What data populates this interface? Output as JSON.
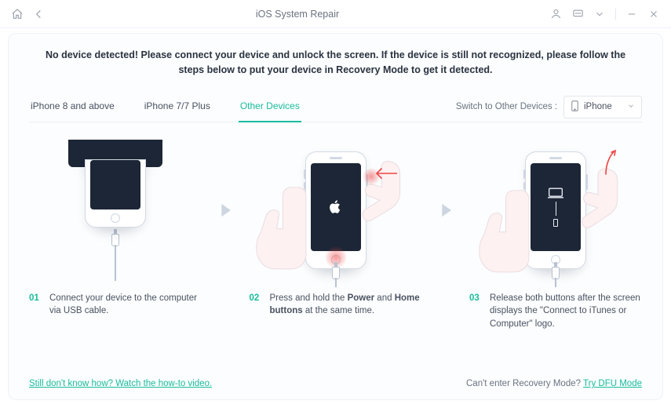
{
  "titlebar": {
    "title": "iOS System Repair"
  },
  "instructions": "No device detected! Please connect your device and unlock the screen. If the device is still not recognized, please follow the steps below to put your device in Recovery Mode to get it detected.",
  "tabs": {
    "items": [
      {
        "label": "iPhone 8 and above"
      },
      {
        "label": "iPhone 7/7 Plus"
      },
      {
        "label": "Other Devices"
      }
    ],
    "active_index": 2
  },
  "switch": {
    "label": "Switch to Other Devices :",
    "selected": "iPhone"
  },
  "steps": [
    {
      "num": "01",
      "text_before": "Connect your device to the computer via USB cable.",
      "bold1": "",
      "mid": "",
      "bold2": "",
      "text_after": ""
    },
    {
      "num": "02",
      "text_before": "Press and hold the ",
      "bold1": "Power",
      "mid": " and ",
      "bold2": "Home buttons",
      "text_after": " at the same time."
    },
    {
      "num": "03",
      "text_before": "Release both buttons after the screen displays the \"Connect to iTunes or Computer\" logo.",
      "bold1": "",
      "mid": "",
      "bold2": "",
      "text_after": ""
    }
  ],
  "footer": {
    "howto": "Still don't know how? Watch the how-to video.",
    "dfu_q": "Can't enter Recovery Mode? ",
    "dfu_link": "Try DFU Mode"
  }
}
